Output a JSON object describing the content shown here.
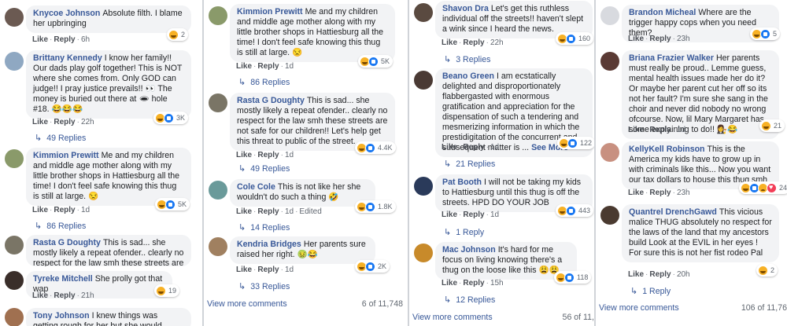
{
  "col1": [
    {
      "author": "Knycoe Johnson",
      "text": "Absolute filth. I blame her upbringing",
      "like": "Like",
      "reply": "Reply",
      "time": "6h",
      "react_count": "2"
    },
    {
      "author": "Brittany Kennedy",
      "text": "I know her family!! Our dads play golf together! This is NOT where she comes from. Only GOD can judge!! I pray justice prevails!! 👀 The money is buried out there at 🕳 hole #18. 😂😂😂",
      "like": "Like",
      "reply": "Reply",
      "time": "22h",
      "react_count": "3K",
      "replies": "49 Replies"
    },
    {
      "author": "Kimmion Prewitt",
      "text": "Me and my children and middle age mother along with my little brother shops in Hattiesburg all the time! I don't feel safe knowing this thug is still at large. 😒",
      "like": "Like",
      "reply": "Reply",
      "time": "1d",
      "react_count": "5K",
      "replies": "86 Replies"
    },
    {
      "author": "Rasta G Doughty",
      "text": "This is sad... she mostly likely a repeat ofender.. clearly no respect for the law smh these streets are not safe"
    },
    {
      "author": "Tyreke Mitchell",
      "text": "She prolly got that wap",
      "like": "Like",
      "reply": "Reply",
      "time": "21h",
      "react_count": "19"
    },
    {
      "author": "Tony Johnson",
      "text": "I knew things was getting rough for her but she would never I told her"
    }
  ],
  "col2": [
    {
      "author": "Kimmion Prewitt",
      "text": "Me and my children and middle age mother along with my little brother shops in Hattiesburg all the time! I don't feel safe knowing this thug is still at large. 😒",
      "like": "Like",
      "reply": "Reply",
      "time": "1d",
      "react_count": "5K",
      "replies": "86 Replies"
    },
    {
      "author": "Rasta G Doughty",
      "text": "This is sad... she mostly likely a repeat ofender.. clearly no respect for the law smh these streets are not safe for our children!! Let's help get this threat to public of the street.",
      "like": "Like",
      "reply": "Reply",
      "time": "1d",
      "react_count": "4.4K",
      "replies": "49 Replies"
    },
    {
      "author": "Cole Cole",
      "text": "This is not like her she wouldn't do such a thing 🤣",
      "like": "Like",
      "reply": "Reply",
      "time": "1d",
      "edited": "Edited",
      "react_count": "1.8K",
      "replies": "14 Replies"
    },
    {
      "author": "Kendria Bridges",
      "text": "Her parents sure raised her right. 🤢😂",
      "like": "Like",
      "reply": "Reply",
      "time": "1d",
      "react_count": "2K",
      "replies": "33 Replies"
    }
  ],
  "col2_footer": {
    "view_more": "View more comments",
    "count": "6 of 11,748"
  },
  "col3": [
    {
      "author": "Shavon Dra",
      "text": "Let's get this ruthless individual off the streets!! haven't slept a wink since I heard the news.",
      "like": "Like",
      "reply": "Reply",
      "time": "22h",
      "react_count": "160",
      "replies": "3 Replies"
    },
    {
      "author": "Beano Green",
      "text": "I am ecstatically delighted and disproportionately flabbergasted with enormous gratification and appreciation for the dispensation of such a tendering and mesmerizing information in which the prestidigitation of the concurrent and subsequent matter is ...",
      "see_more": "See More",
      "like": "Like",
      "reply": "Reply",
      "time": "1d",
      "react_count": "122",
      "replies": "21 Replies"
    },
    {
      "author": "Pat Booth",
      "text": "I will not be taking my kids to Hattiesburg until this thug is off the streets. HPD DO YOUR JOB",
      "like": "Like",
      "reply": "Reply",
      "time": "1d",
      "react_count": "443",
      "replies": "1 Reply"
    },
    {
      "author": "Mac Johnson",
      "text": "It's hard for me focus on living knowing there's a thug on the loose like this 😩😩",
      "like": "Like",
      "reply": "Reply",
      "time": "15h",
      "react_count": "118",
      "replies": "12 Replies"
    }
  ],
  "col3_footer": {
    "view_more": "View more comments",
    "count": "56 of 11,"
  },
  "col4": [
    {
      "author": "Brandon Micheal",
      "text": "Where are the trigger happy cops when you need them?",
      "like": "Like",
      "reply": "Reply",
      "time": "23h",
      "react_count": "5"
    },
    {
      "author": "Briana Frazier Walker",
      "text": "Her parents must really be proud.. Lemme guess, mental health issues made her do it? Or maybe her parent cut her off so its not her fault? I'm sure she sang in the choir and never did nobody no wrong ofcourse. Now, lil Mary Margaret has some explaining to do!! 👩‍⚖️😂",
      "like": "Like",
      "reply": "Reply",
      "time": "1d",
      "react_count": "21"
    },
    {
      "author": "KellyKell Robinson",
      "text": "This is the America my kids have to grow up in with criminals like this... Now you want our tax dollars to house this thug smh",
      "like": "Like",
      "reply": "Reply",
      "time": "23h",
      "react_count": "24"
    },
    {
      "author": "Quantrel DrenchGawd",
      "text": "This vicious malice THUG absolutely no respect for the laws of the land that my ancestors build Look at the EVIL in her eyes ! For sure this is not her fist rodeo Pal",
      "like": "Like",
      "reply": "Reply",
      "time": "20h",
      "react_count": "2",
      "replies": "1 Reply"
    }
  ],
  "col4_footer": {
    "view_more": "View more comments",
    "count": "106 of 11,76"
  },
  "colors": {
    "link": "#385898",
    "bubble": "#f2f3f5",
    "meta": "#606770",
    "haha": "#f7b125",
    "like": "#1877f2",
    "love": "#f33e58"
  }
}
